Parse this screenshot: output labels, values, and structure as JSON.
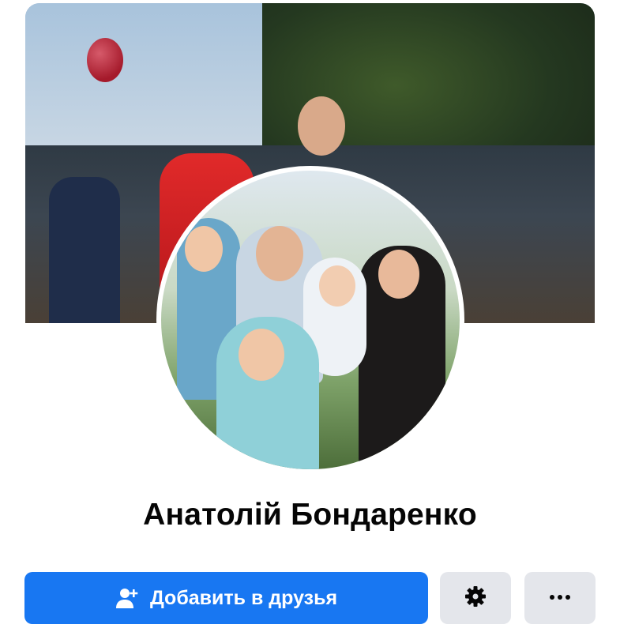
{
  "profile": {
    "name": "Анатолій Бондаренко"
  },
  "actions": {
    "add_friend_label": "Добавить в друзья",
    "add_friend_icon": "add-user-icon",
    "settings_icon": "gear-icon",
    "more_icon": "more-dots-icon"
  },
  "colors": {
    "primary": "#1877f2",
    "secondary_button": "#e4e6eb",
    "text": "#050505"
  }
}
